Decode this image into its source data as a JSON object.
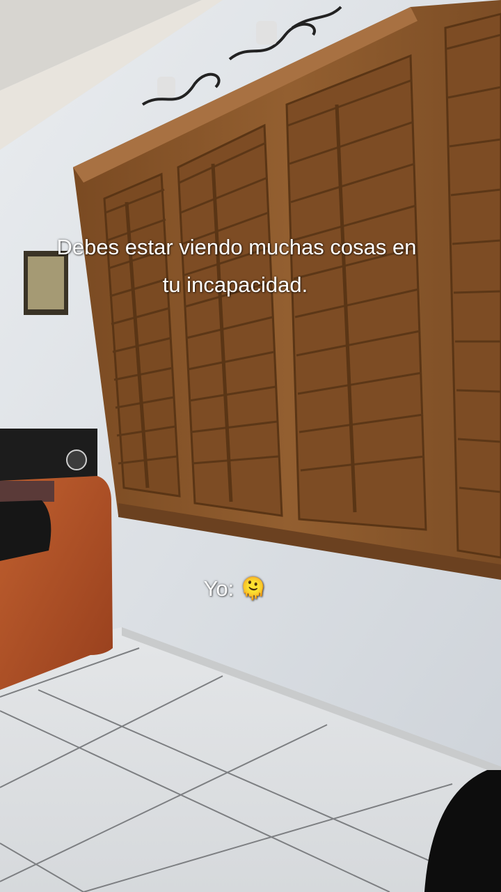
{
  "captions": {
    "line1": "Debes estar viendo muchas cosas en",
    "line2": "tu incapacidad.",
    "reply": "Yo: 🫠"
  },
  "colors": {
    "wall": "#dfe3e8",
    "wood": "#8a5a2e",
    "sofa": "#b2542a",
    "floor": "#e6e8ea",
    "caption_text": "#ffffff"
  }
}
